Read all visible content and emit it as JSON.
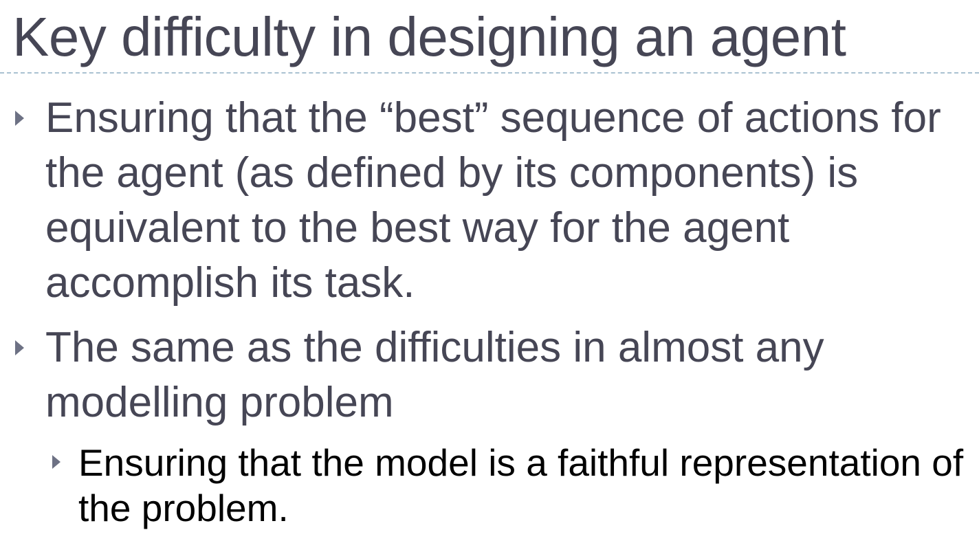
{
  "slide": {
    "title": "Key difficulty in designing an agent",
    "bullets": [
      {
        "level": 1,
        "text": "Ensuring that the “best” sequence of actions for the agent (as defined by its components) is equivalent to the best way for the agent accomplish its task."
      },
      {
        "level": 1,
        "text": "The same as the difficulties in almost any modelling problem"
      },
      {
        "level": 2,
        "text": "Ensuring that the model is a faithful representation of the problem."
      }
    ]
  },
  "colors": {
    "title_text": "#464655",
    "body_text": "#464655",
    "sub_bullet_text": "#000000",
    "bullet_marker": "#6d7184",
    "divider": "#a9c1d1"
  },
  "icons": {
    "bullet_marker": "triangle-right-icon"
  }
}
